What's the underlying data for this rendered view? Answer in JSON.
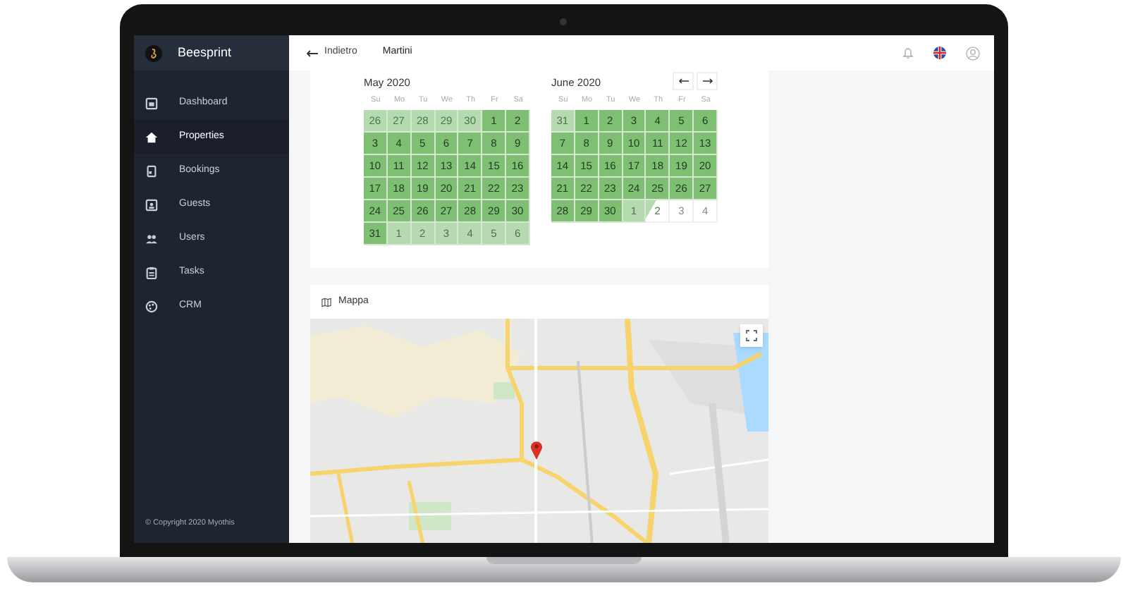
{
  "app": {
    "brand": "Beesprint",
    "copyright": "© Copyright 2020 Myothis"
  },
  "sidebar": {
    "items": [
      {
        "label": "Dashboard",
        "selected": false
      },
      {
        "label": "Properties",
        "selected": true
      },
      {
        "label": "Bookings",
        "selected": false
      },
      {
        "label": "Guests",
        "selected": false
      },
      {
        "label": "Users",
        "selected": false
      },
      {
        "label": "Tasks",
        "selected": false
      },
      {
        "label": "CRM",
        "selected": false
      }
    ]
  },
  "topbar": {
    "back": "Indietro",
    "title": "Martini"
  },
  "calendar": {
    "months": [
      {
        "title": "May 2020",
        "weekdays": [
          "Su",
          "Mo",
          "Tu",
          "We",
          "Th",
          "Fr",
          "Sa"
        ],
        "days": [
          {
            "label": "26",
            "kind": "outside"
          },
          {
            "label": "27",
            "kind": "outside"
          },
          {
            "label": "28",
            "kind": "outside"
          },
          {
            "label": "29",
            "kind": "outside"
          },
          {
            "label": "30",
            "kind": "outside"
          },
          {
            "label": "1",
            "kind": "booked"
          },
          {
            "label": "2",
            "kind": "booked"
          },
          {
            "label": "3",
            "kind": "booked"
          },
          {
            "label": "4",
            "kind": "booked"
          },
          {
            "label": "5",
            "kind": "booked"
          },
          {
            "label": "6",
            "kind": "booked"
          },
          {
            "label": "7",
            "kind": "booked"
          },
          {
            "label": "8",
            "kind": "booked"
          },
          {
            "label": "9",
            "kind": "booked"
          },
          {
            "label": "10",
            "kind": "booked"
          },
          {
            "label": "11",
            "kind": "booked"
          },
          {
            "label": "12",
            "kind": "booked"
          },
          {
            "label": "13",
            "kind": "booked"
          },
          {
            "label": "14",
            "kind": "booked"
          },
          {
            "label": "15",
            "kind": "booked"
          },
          {
            "label": "16",
            "kind": "booked"
          },
          {
            "label": "17",
            "kind": "booked"
          },
          {
            "label": "18",
            "kind": "booked"
          },
          {
            "label": "19",
            "kind": "booked"
          },
          {
            "label": "20",
            "kind": "booked"
          },
          {
            "label": "21",
            "kind": "booked"
          },
          {
            "label": "22",
            "kind": "booked"
          },
          {
            "label": "23",
            "kind": "booked"
          },
          {
            "label": "24",
            "kind": "booked"
          },
          {
            "label": "25",
            "kind": "booked"
          },
          {
            "label": "26",
            "kind": "booked"
          },
          {
            "label": "27",
            "kind": "booked"
          },
          {
            "label": "28",
            "kind": "booked"
          },
          {
            "label": "29",
            "kind": "booked"
          },
          {
            "label": "30",
            "kind": "booked"
          },
          {
            "label": "31",
            "kind": "booked"
          },
          {
            "label": "1",
            "kind": "outside"
          },
          {
            "label": "2",
            "kind": "outside"
          },
          {
            "label": "3",
            "kind": "outside"
          },
          {
            "label": "4",
            "kind": "outside"
          },
          {
            "label": "5",
            "kind": "outside"
          },
          {
            "label": "6",
            "kind": "outside"
          }
        ]
      },
      {
        "title": "June 2020",
        "weekdays": [
          "Su",
          "Mo",
          "Tu",
          "We",
          "Th",
          "Fr",
          "Sa"
        ],
        "days": [
          {
            "label": "31",
            "kind": "outside"
          },
          {
            "label": "1",
            "kind": "booked"
          },
          {
            "label": "2",
            "kind": "booked"
          },
          {
            "label": "3",
            "kind": "booked"
          },
          {
            "label": "4",
            "kind": "booked"
          },
          {
            "label": "5",
            "kind": "booked"
          },
          {
            "label": "6",
            "kind": "booked"
          },
          {
            "label": "7",
            "kind": "booked"
          },
          {
            "label": "8",
            "kind": "booked"
          },
          {
            "label": "9",
            "kind": "booked"
          },
          {
            "label": "10",
            "kind": "booked"
          },
          {
            "label": "11",
            "kind": "booked"
          },
          {
            "label": "12",
            "kind": "booked"
          },
          {
            "label": "13",
            "kind": "booked"
          },
          {
            "label": "14",
            "kind": "booked"
          },
          {
            "label": "15",
            "kind": "booked"
          },
          {
            "label": "16",
            "kind": "booked"
          },
          {
            "label": "17",
            "kind": "booked"
          },
          {
            "label": "18",
            "kind": "booked"
          },
          {
            "label": "19",
            "kind": "booked"
          },
          {
            "label": "20",
            "kind": "booked"
          },
          {
            "label": "21",
            "kind": "booked"
          },
          {
            "label": "22",
            "kind": "booked"
          },
          {
            "label": "23",
            "kind": "booked"
          },
          {
            "label": "24",
            "kind": "booked"
          },
          {
            "label": "25",
            "kind": "booked"
          },
          {
            "label": "26",
            "kind": "booked"
          },
          {
            "label": "27",
            "kind": "booked"
          },
          {
            "label": "28",
            "kind": "booked"
          },
          {
            "label": "29",
            "kind": "booked"
          },
          {
            "label": "30",
            "kind": "booked"
          },
          {
            "label": "1",
            "kind": "outside"
          },
          {
            "label": "2",
            "kind": "checkout"
          },
          {
            "label": "3",
            "kind": "free"
          },
          {
            "label": "4",
            "kind": "free"
          }
        ]
      }
    ]
  },
  "map": {
    "title": "Mappa"
  }
}
